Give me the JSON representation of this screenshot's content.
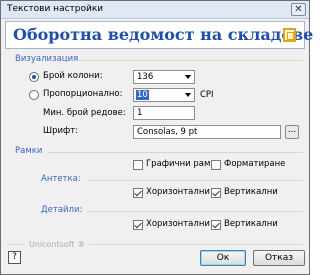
{
  "window": {
    "title": "Текстови настройки",
    "close_glyph": "✕"
  },
  "banner": {
    "title": "Оборотна ведомост на складове",
    "logo_icon": "app-logo-icon"
  },
  "visualization": {
    "section_label": "Визуализация",
    "columns_radio_label": "Брой колони:",
    "columns_value": "136",
    "proportional_radio_label": "Пропорционално:",
    "proportional_value": "10",
    "cpi_label": "CPI",
    "min_rows_label": "Мин. брой редове:",
    "min_rows_value": "1",
    "font_label": "Шрифт:",
    "font_value": "Consolas, 9 pt",
    "font_browse_label": "..."
  },
  "frames": {
    "section_label": "Рамки",
    "graphic_frames_label": "Графични рамки",
    "formatting_label": "Форматиране",
    "header_label": "Антетка:",
    "header_horizontal_label": "Хоризонтални",
    "header_vertical_label": "Вертикални",
    "details_label": "Детайли:",
    "details_horizontal_label": "Хоризонтални",
    "details_vertical_label": "Вертикални"
  },
  "footer": {
    "brand": "Unicontsoft ®",
    "help_glyph": "?",
    "ok_label": "Ок",
    "cancel_label": "Отказ"
  },
  "colors": {
    "accent": "#1f4fa8",
    "section": "#3b63c1",
    "selection": "#316ac5"
  }
}
